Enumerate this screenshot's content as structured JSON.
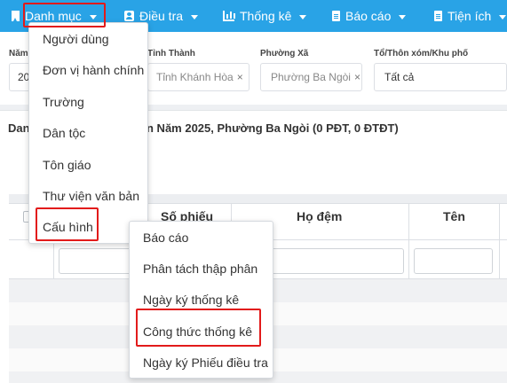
{
  "nav": {
    "items": [
      {
        "label": "Danh mục",
        "icon": "bookmark-icon"
      },
      {
        "label": "Điều tra",
        "icon": "user-card-icon"
      },
      {
        "label": "Thống kê",
        "icon": "bar-chart-icon"
      },
      {
        "label": "Báo cáo",
        "icon": "document-icon"
      },
      {
        "label": "Tiện ích",
        "icon": "document-icon"
      }
    ]
  },
  "filters": {
    "year_label": "Năm",
    "year_value": "20",
    "province_label": "Tỉnh Thành",
    "province_value": "Tỉnh Khánh Hòa",
    "ward_label": "Phường Xã",
    "ward_value": "Phường Ba Ngòi",
    "hamlet_label": "Tổ/Thôn xóm/Khu phố",
    "hamlet_value": "Tất cả",
    "clear_symbol": "×"
  },
  "content": {
    "title_prefix": "Dan",
    "title_suffix": "n Năm 2025, Phường Ba Ngòi (0 PĐT, 0 ĐTĐT)"
  },
  "table": {
    "headers": [
      "Số phiếu",
      "Họ đệm",
      "Tên"
    ]
  },
  "menu_danh_muc": {
    "items": [
      "Người dùng",
      "Đơn vị hành chính",
      "Trường",
      "Dân tộc",
      "Tôn giáo",
      "Thư viện văn bản",
      "Cấu hình"
    ]
  },
  "menu_cau_hinh": {
    "items": [
      "Báo cáo",
      "Phân tách thập phân",
      "Ngày ký thống kê",
      "Công thức thống kê",
      "Ngày ký Phiếu điều tra"
    ]
  },
  "colors": {
    "navbar": "#29a3e6",
    "highlight": "#e21b1b"
  }
}
